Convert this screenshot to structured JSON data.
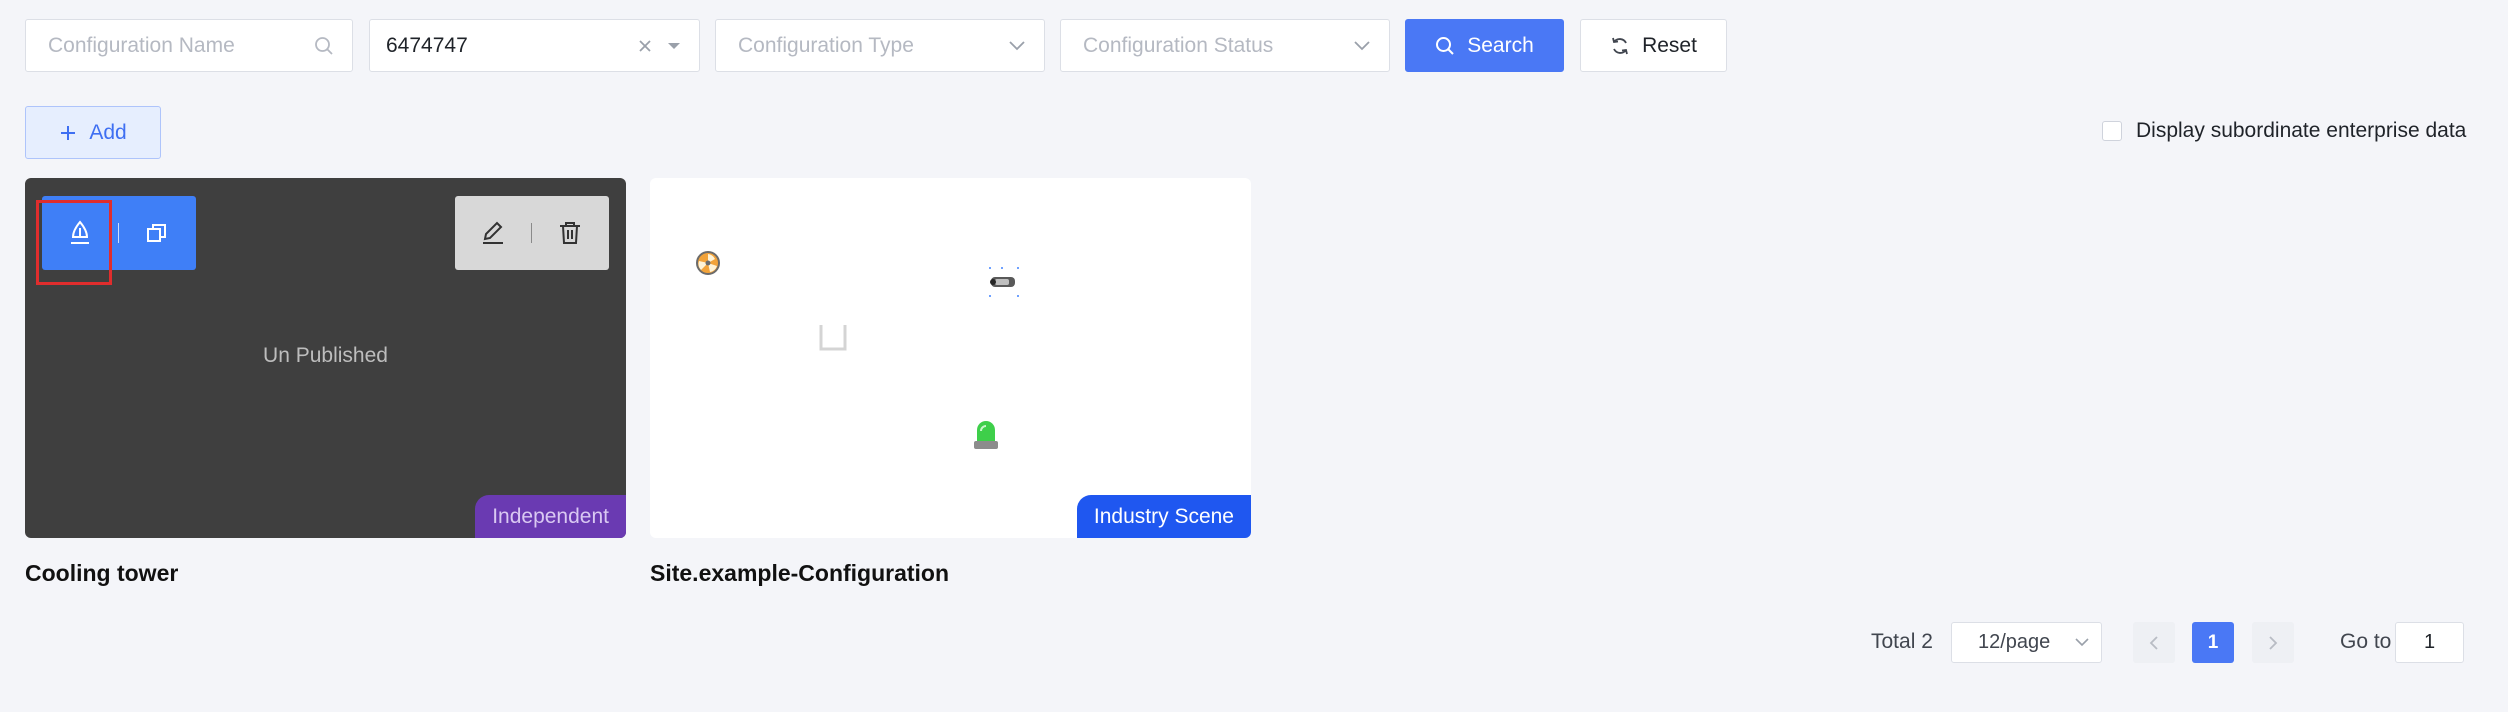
{
  "filters": {
    "name_placeholder": "Configuration Name",
    "id_value": "6474747",
    "type_placeholder": "Configuration Type",
    "status_placeholder": "Configuration Status",
    "search_label": "Search",
    "reset_label": "Reset"
  },
  "toolbar": {
    "add_label": "Add",
    "subordinate_label": "Display subordinate enterprise data",
    "subordinate_checked": false
  },
  "cards": [
    {
      "title": "Cooling tower",
      "status_text": "Un Published",
      "tag": "Independent",
      "actions": [
        "publish-icon",
        "copy-icon",
        "edit-icon",
        "delete-icon"
      ]
    },
    {
      "title": "Site.example-Configuration",
      "tag": "Industry Scene",
      "preview_icons": [
        "fan-icon",
        "pump-icon",
        "frame-icon",
        "alarm-light-icon"
      ]
    }
  ],
  "pagination": {
    "total_text": "Total 2",
    "page_size": "12/page",
    "current_page": "1",
    "goto_label": "Go to",
    "goto_value": "1"
  },
  "colors": {
    "primary": "#4a78f5",
    "card_dark": "#3f3f3f",
    "tag_independent": "#6a3ab2",
    "tag_industry": "#1f57f0",
    "highlight": "#e02d2d"
  }
}
